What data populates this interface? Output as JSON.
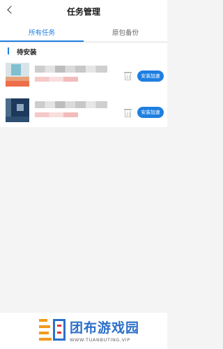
{
  "header": {
    "title": "任务管理",
    "back_icon": "chevron-left-icon"
  },
  "tabs": [
    {
      "label": "所有任务",
      "active": true
    },
    {
      "label": "原包备份",
      "active": false
    }
  ],
  "section": {
    "title": "待安装"
  },
  "tasks": [
    {
      "button_label": "安装加速"
    },
    {
      "button_label": "安装加速"
    }
  ],
  "banner": {
    "name": "团布游戏园",
    "url": "WWW.TUANBUTING.VIP"
  },
  "colors": {
    "accent": "#1f7fe0",
    "background": "#f4f4f4"
  }
}
